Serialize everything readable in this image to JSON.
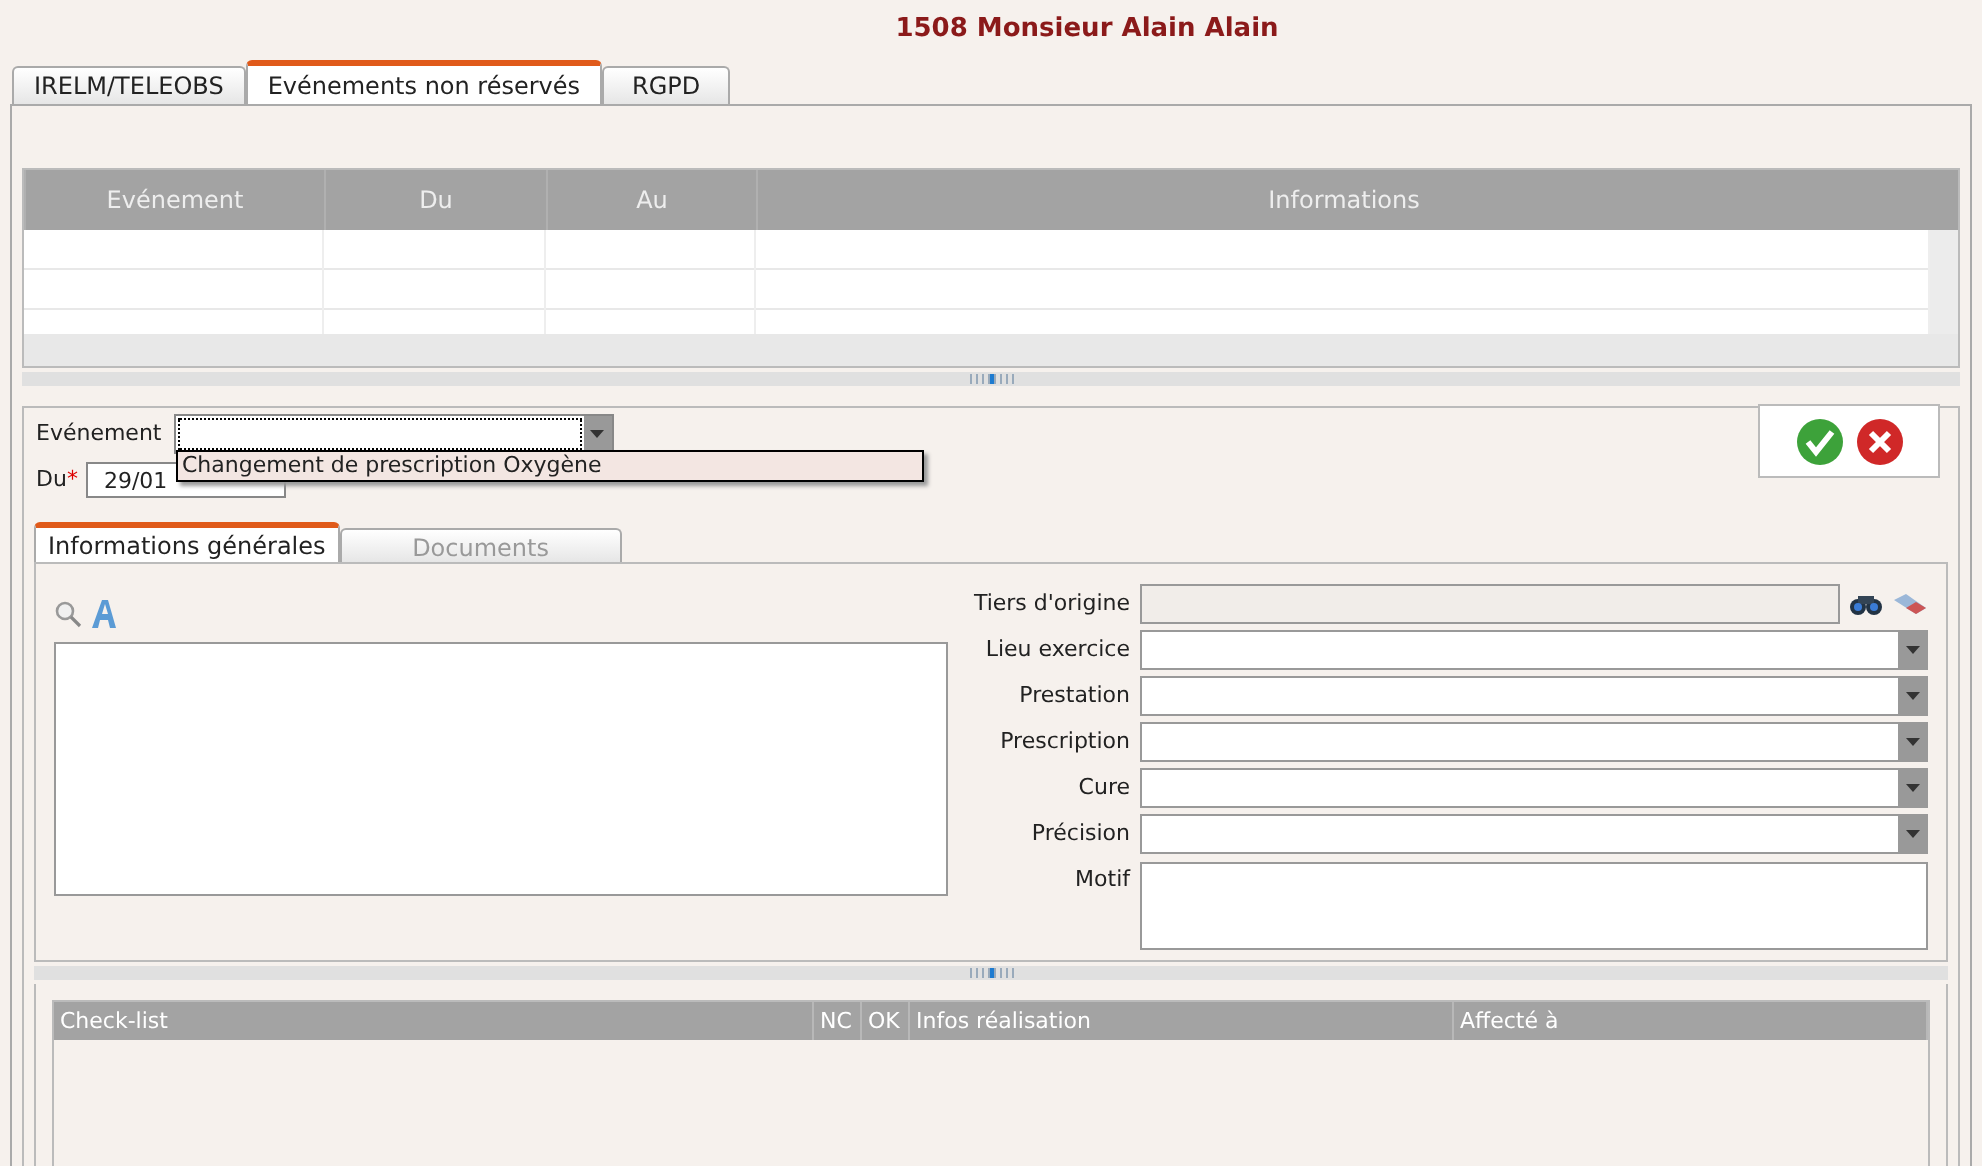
{
  "title": "1508 Monsieur Alain Alain",
  "tabs": [
    {
      "label": "IRELM/TELEOBS",
      "selected": false
    },
    {
      "label": "Evénements non réservés",
      "selected": true
    },
    {
      "label": "RGPD",
      "selected": false
    }
  ],
  "events_table": {
    "columns": [
      "Evénement",
      "Du",
      "Au",
      "Informations"
    ]
  },
  "event_form": {
    "event_label": "Evénement",
    "event_options": [
      "Changement de prescription Oxygène"
    ],
    "date_label": "Du",
    "required_mark": "*",
    "date_value": "29/01"
  },
  "sub_tabs": [
    {
      "label": "Informations générales",
      "selected": true
    },
    {
      "label": "Documents",
      "selected": false
    }
  ],
  "fields": [
    {
      "label": "Tiers d'origine",
      "kind": "lookup"
    },
    {
      "label": "Lieu exercice",
      "kind": "select"
    },
    {
      "label": "Prestation",
      "kind": "select"
    },
    {
      "label": "Prescription",
      "kind": "select"
    },
    {
      "label": "Cure",
      "kind": "select"
    },
    {
      "label": "Précision",
      "kind": "select"
    },
    {
      "label": "Motif",
      "kind": "textarea"
    }
  ],
  "checklist": {
    "columns": [
      "Check-list",
      "NC",
      "OK",
      "Infos réalisation",
      "Affecté à"
    ]
  }
}
